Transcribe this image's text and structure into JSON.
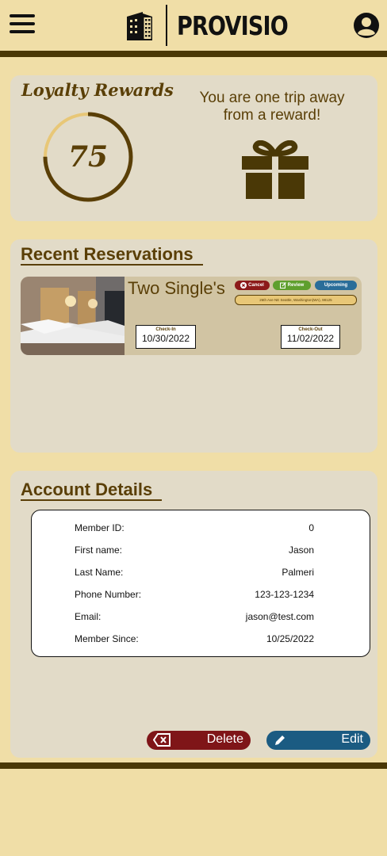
{
  "header": {
    "brand": "PROVISIO"
  },
  "loyalty": {
    "title": "Loyalty Rewards",
    "points": "75",
    "progress": 0.75,
    "message": "You are one trip away from a reward!"
  },
  "reservations": {
    "title": "Recent Reservations",
    "items": [
      {
        "room": "Two Single's",
        "cancel_label": "Cancel",
        "review_label": "Review",
        "status": "Upcoming",
        "address": "26th Ave NE Seattle, Washington(WA), 98125",
        "checkin_label": "Check-In",
        "checkin": "10/30/2022",
        "checkout_label": "Check-Out",
        "checkout": "11/02/2022"
      }
    ]
  },
  "account": {
    "title": "Account Details",
    "fields": [
      {
        "label": "Member ID:",
        "value": "0"
      },
      {
        "label": "First name:",
        "value": "Jason"
      },
      {
        "label": "Last Name:",
        "value": "Palmeri"
      },
      {
        "label": "Phone Number:",
        "value": "123-123-1234"
      },
      {
        "label": "Email:",
        "value": "jason@test.com"
      },
      {
        "label": "Member Since:",
        "value": "10/25/2022"
      }
    ],
    "delete_label": "Delete",
    "edit_label": "Edit"
  },
  "colors": {
    "background": "#f0dea7",
    "card": "#e2dbc8",
    "brown": "#5a3f07",
    "delete": "#7f1518",
    "edit": "#1b5b82"
  }
}
